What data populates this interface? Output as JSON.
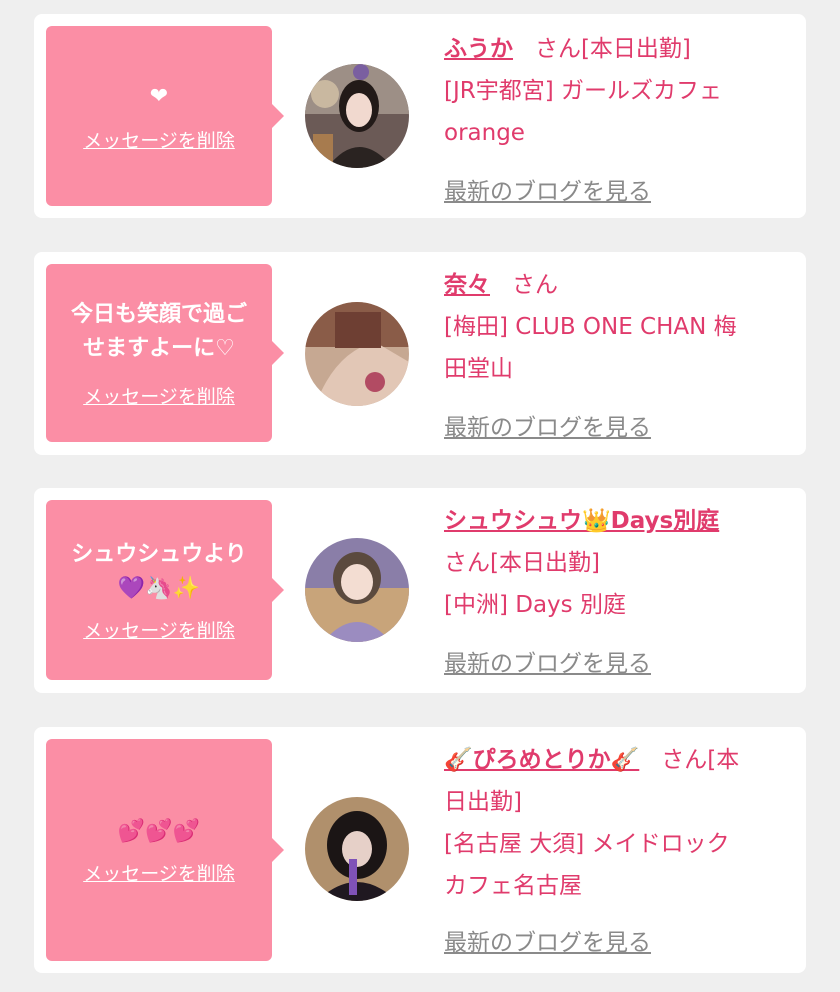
{
  "delete_label": "メッセージを削除",
  "blog_label": "最新のブログを見る",
  "cards": [
    {
      "message": "❤",
      "name": "ふうか",
      "suffix": "さん[本日出勤]",
      "shop_lines": [
        "[JR宇都宮] ガールズカフェ",
        "orange"
      ]
    },
    {
      "message_lines": [
        "今日も笑顔で過ご",
        "せますよーに♡"
      ],
      "name": "奈々",
      "suffix": "さん",
      "shop_lines": [
        "[梅田] CLUB ONE CHAN 梅",
        "田堂山"
      ]
    },
    {
      "message_lines": [
        "シュウシュウより",
        "💜🦄✨"
      ],
      "name": "シュウシュウ👑Days別庭",
      "suffix_lines": [
        "さん[本日出勤]"
      ],
      "shop_lines": [
        "[中洲] Days 別庭"
      ]
    },
    {
      "message": "💕💕💕",
      "name": "🎸ぴろめとりか🎸",
      "suffix": "さん[本",
      "suffix_lines": [
        "日出勤]"
      ],
      "shop_lines": [
        "[名古屋 大須] メイドロック",
        "カフェ名古屋"
      ]
    }
  ]
}
